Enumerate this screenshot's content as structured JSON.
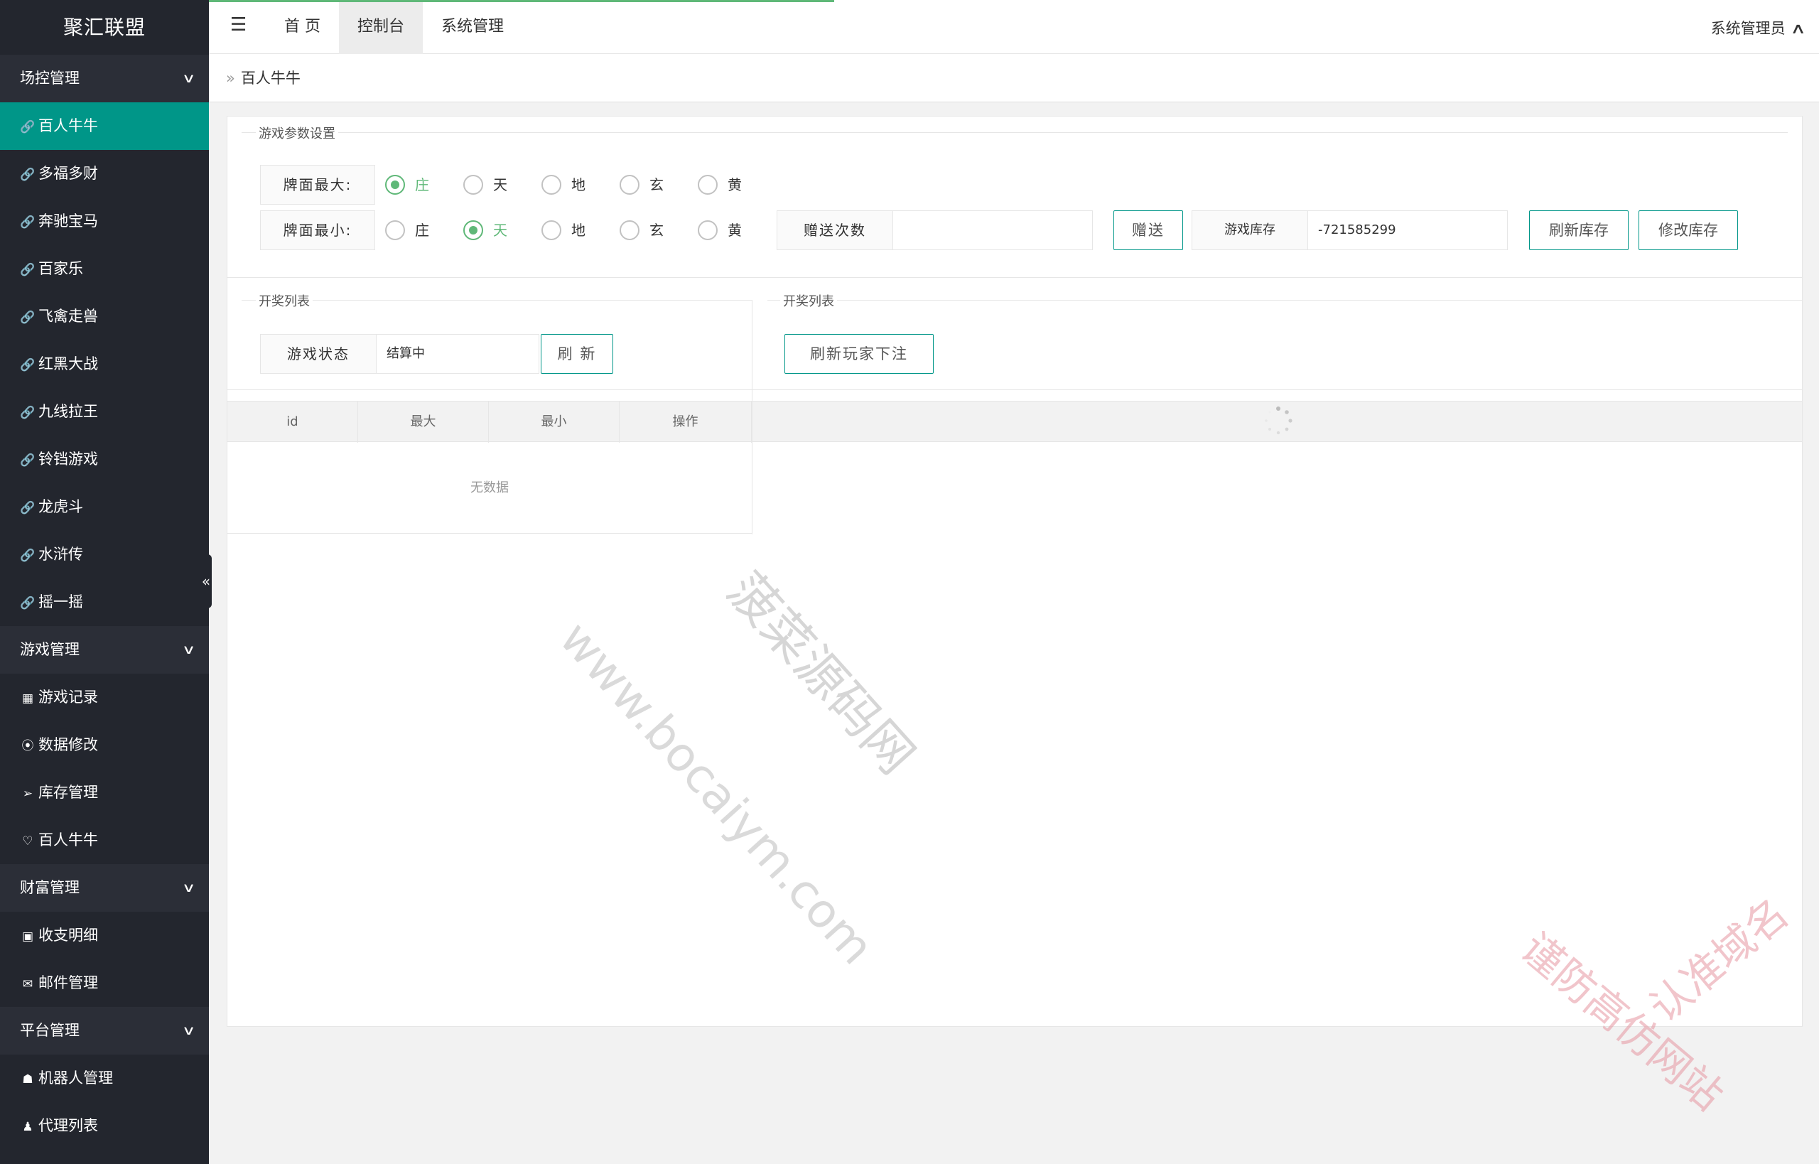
{
  "app": {
    "title": "聚汇联盟"
  },
  "sidebar": {
    "groups": [
      {
        "label": "场控管理",
        "items": [
          "百人牛牛",
          "多福多财",
          "奔驰宝马",
          "百家乐",
          "飞禽走兽",
          "红黑大战",
          "九线拉王",
          "铃铛游戏",
          "龙虎斗",
          "水浒传",
          "摇一摇"
        ]
      },
      {
        "label": "游戏管理",
        "items": [
          "游戏记录",
          "数据修改",
          "库存管理",
          "百人牛牛"
        ]
      },
      {
        "label": "财富管理",
        "items": [
          "收支明细",
          "邮件管理"
        ]
      },
      {
        "label": "平台管理",
        "items": [
          "机器人管理",
          "代理列表"
        ]
      }
    ],
    "collapse_glyph": "«"
  },
  "header": {
    "tabs": [
      "首 页",
      "控制台",
      "系统管理"
    ],
    "user": "系统管理员"
  },
  "breadcrumb": {
    "sep": "»",
    "current": "百人牛牛"
  },
  "params": {
    "legend": "游戏参数设置",
    "max_label": "牌面最大:",
    "min_label": "牌面最小:",
    "options": [
      "庄",
      "天",
      "地",
      "玄",
      "黄"
    ],
    "max_selected": "庄",
    "min_selected": "天",
    "gift_label": "赠送次数",
    "gift_value": "",
    "gift_button": "赠送",
    "stock_label": "游戏库存",
    "stock_value": "-721585299",
    "refresh_stock_button": "刷新库存",
    "modify_stock_button": "修改库存"
  },
  "lottery_left": {
    "legend": "开奖列表",
    "status_label": "游戏状态",
    "status_value": "结算中",
    "refresh_button": "刷 新",
    "columns": [
      "id",
      "最大",
      "最小",
      "操作"
    ],
    "empty_text": "无数据"
  },
  "lottery_right": {
    "legend": "开奖列表",
    "refresh_bets_button": "刷新玩家下注"
  },
  "watermarks": {
    "site": "www.bocaiym.com",
    "name": "菠菜源码网",
    "notice_1": "认准域名",
    "notice_2": "谨防高仿网站"
  },
  "colors": {
    "accent": "#009688",
    "radio_on": "#5fb878",
    "sidebar": "#23262e"
  }
}
